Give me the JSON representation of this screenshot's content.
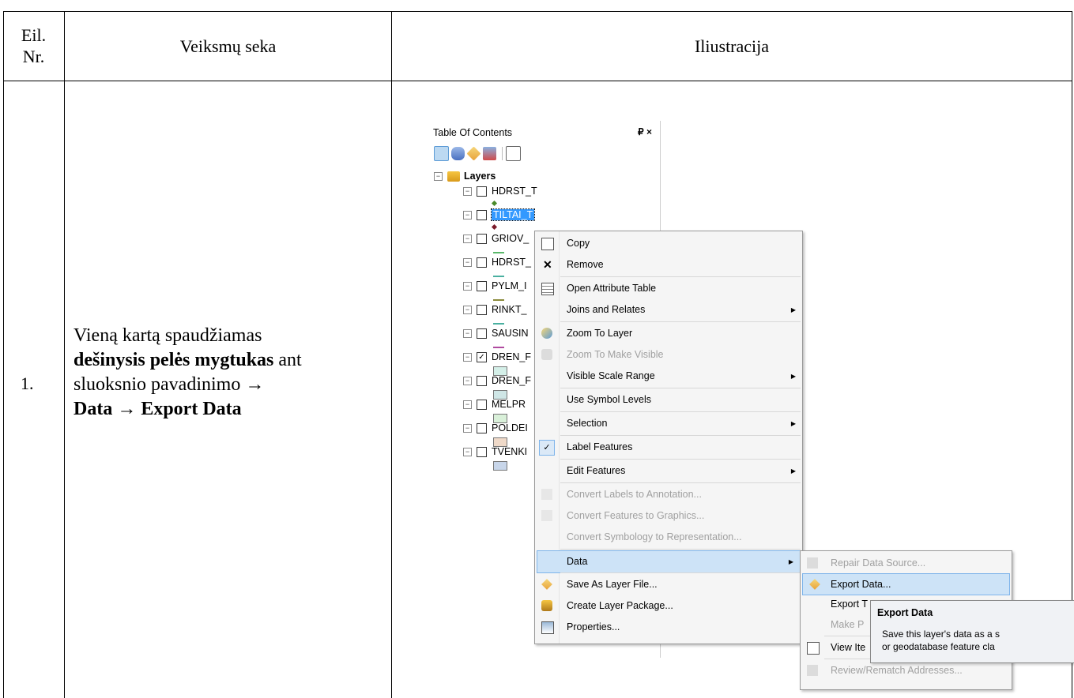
{
  "table": {
    "header": {
      "col1": "Eil. Nr.",
      "col1_line1": "Eil.",
      "col1_line2": "Nr.",
      "col2": "Veiksmų seka",
      "col3": "Iliustracija"
    },
    "row1": {
      "number": "1.",
      "desc_part1": "Vieną kartą spaudžiamas",
      "desc_bold1": "dešinysis pelės mygtukas",
      "desc_part2": " ant",
      "desc_part3": "sluoksnio pavadinimo →",
      "desc_bold2": "Data → Export Data"
    }
  },
  "toc": {
    "title": "Table Of Contents",
    "pin": "₽ ×",
    "root": "Layers",
    "layers": [
      {
        "name": "HDRST_T",
        "checked": false,
        "symbol": "point",
        "color": "#4a8a2a"
      },
      {
        "name": "TILTAI_T",
        "checked": false,
        "symbol": "point",
        "color": "#7a1a2a",
        "selected": true
      },
      {
        "name": "GRIOV_",
        "checked": false,
        "symbol": "line",
        "color": "#5ab86a"
      },
      {
        "name": "HDRST_",
        "checked": false,
        "symbol": "line",
        "color": "#4ab0a0"
      },
      {
        "name": "PYLM_I",
        "checked": false,
        "symbol": "line",
        "color": "#8a8a3a"
      },
      {
        "name": "RINKT_",
        "checked": false,
        "symbol": "line",
        "color": "#4ab0a0"
      },
      {
        "name": "SAUSIN",
        "checked": false,
        "symbol": "line",
        "color": "#b04aa0"
      },
      {
        "name": "DREN_F",
        "checked": true,
        "symbol": "poly",
        "color": "#d4efe8"
      },
      {
        "name": "DREN_F",
        "checked": false,
        "symbol": "poly",
        "color": "#cfe6e6"
      },
      {
        "name": "MELPR",
        "checked": false,
        "symbol": "poly",
        "color": "#d9f0d9"
      },
      {
        "name": "POLDEI",
        "checked": false,
        "symbol": "poly",
        "color": "#efd9c8"
      },
      {
        "name": "TVENKI",
        "checked": false,
        "symbol": "poly",
        "color": "#c8d6ea"
      }
    ]
  },
  "context_menu": {
    "items": [
      {
        "label": "Copy",
        "icon": "copy-icon"
      },
      {
        "label": "Remove",
        "icon": "remove-icon"
      },
      {
        "label": "Open Attribute Table",
        "icon": "table-icon"
      },
      {
        "label": "Joins and Relates",
        "submenu": true
      },
      {
        "label": "Zoom To Layer",
        "icon": "zoom-layer-icon"
      },
      {
        "label": "Zoom To Make Visible",
        "disabled": true,
        "icon": "zoom-visible-icon"
      },
      {
        "label": "Visible Scale Range",
        "submenu": true
      },
      {
        "label": "Use Symbol Levels"
      },
      {
        "label": "Selection",
        "submenu": true
      },
      {
        "label": "Label Features",
        "checked": true
      },
      {
        "label": "Edit Features",
        "submenu": true
      },
      {
        "label": "Convert Labels to Annotation...",
        "disabled": true,
        "icon": "convert-labels-icon"
      },
      {
        "label": "Convert Features to Graphics...",
        "disabled": true,
        "icon": "convert-features-icon"
      },
      {
        "label": "Convert Symbology to Representation...",
        "disabled": true
      },
      {
        "label": "Data",
        "submenu": true,
        "highlighted": true
      },
      {
        "label": "Save As Layer File...",
        "icon": "layer-file-icon"
      },
      {
        "label": "Create Layer Package...",
        "icon": "layer-package-icon"
      },
      {
        "label": "Properties...",
        "icon": "properties-icon"
      }
    ]
  },
  "data_submenu": {
    "items": [
      {
        "label": "Repair Data Source...",
        "disabled": true
      },
      {
        "label": "Export Data...",
        "highlighted": true
      },
      {
        "label": "Export T"
      },
      {
        "label": "Make P",
        "disabled": true
      },
      {
        "label": "View Ite"
      },
      {
        "label": "Review/Rematch Addresses...",
        "disabled": true
      }
    ]
  },
  "tooltip": {
    "title": "Export Data",
    "line1": "Save this layer's data as a s",
    "line2": "or geodatabase feature cla"
  }
}
